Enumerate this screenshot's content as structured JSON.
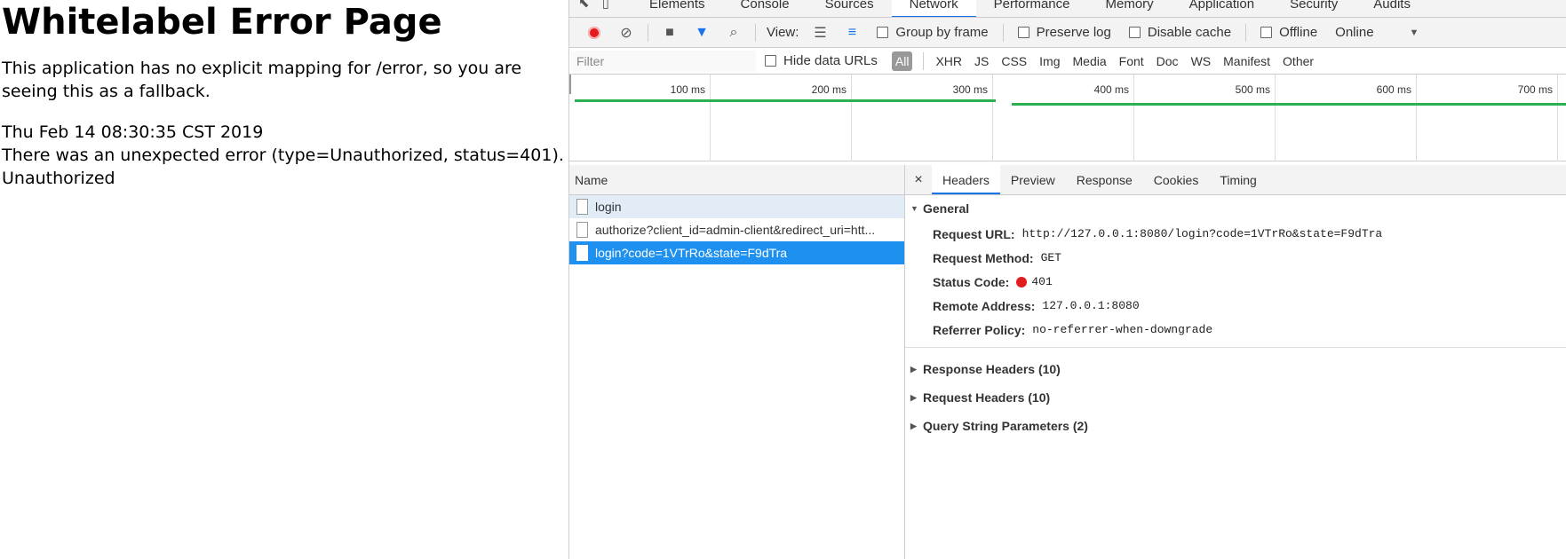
{
  "page": {
    "title": "Whitelabel Error Page",
    "p1": "This application has no explicit mapping for /error, so you are seeing this as a fallback.",
    "timestamp": "Thu Feb 14 08:30:35 CST 2019",
    "error_line": "There was an unexpected error (type=Unauthorized, status=401).",
    "message": "Unauthorized"
  },
  "devtools": {
    "tabs": [
      "Elements",
      "Console",
      "Sources",
      "Network",
      "Performance",
      "Memory",
      "Application",
      "Security",
      "Audits"
    ],
    "active_tab": "Network",
    "toolbar": {
      "view_label": "View:",
      "group_by_frame": "Group by frame",
      "preserve_log": "Preserve log",
      "disable_cache": "Disable cache",
      "offline": "Offline",
      "throttle": "Online"
    },
    "filter": {
      "placeholder": "Filter",
      "hide_data_urls": "Hide data URLs",
      "types": [
        "All",
        "XHR",
        "JS",
        "CSS",
        "Img",
        "Media",
        "Font",
        "Doc",
        "WS",
        "Manifest",
        "Other"
      ]
    },
    "overview_ticks": [
      "100 ms",
      "200 ms",
      "300 ms",
      "400 ms",
      "500 ms",
      "600 ms",
      "700 ms"
    ],
    "name_header": "Name",
    "requests": [
      "login",
      "authorize?client_id=admin-client&redirect_uri=htt...",
      "login?code=1VTrRo&state=F9dTra"
    ],
    "detail_tabs": [
      "Headers",
      "Preview",
      "Response",
      "Cookies",
      "Timing"
    ],
    "close_icon": "×",
    "general": {
      "title": "General",
      "rows": [
        {
          "k": "Request URL:",
          "v": "http://127.0.0.1:8080/login?code=1VTrRo&state=F9dTra"
        },
        {
          "k": "Request Method:",
          "v": "GET"
        },
        {
          "k": "Status Code:",
          "v": "401"
        },
        {
          "k": "Remote Address:",
          "v": "127.0.0.1:8080"
        },
        {
          "k": "Referrer Policy:",
          "v": "no-referrer-when-downgrade"
        }
      ]
    },
    "collapsed_sections": [
      "Response Headers (10)",
      "Request Headers (10)",
      "Query String Parameters (2)"
    ],
    "colors": {
      "accent": "#1a73e8",
      "selected": "#1e90ef",
      "record": "#e61b1b",
      "waterfall": "#29b050",
      "status_error": "#e21c1c"
    }
  }
}
